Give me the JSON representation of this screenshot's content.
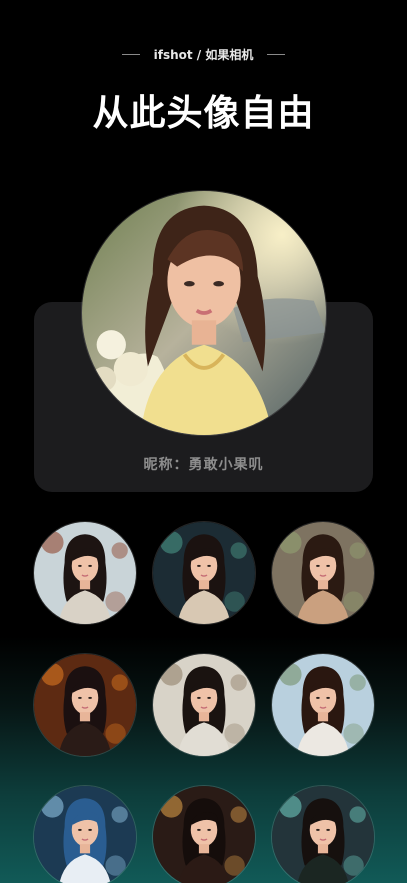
{
  "header": {
    "brand": "ifshot / 如果相机",
    "title": "从此头像自由"
  },
  "profile": {
    "nickname": "昵称：勇敢小果叽",
    "avatar_alt": "main-portrait"
  },
  "gallery": {
    "items": [
      {
        "name": "portrait-train-scarf",
        "bg": "#c9d4d8",
        "hair": "#1d1412",
        "shirt": "#d9d2c6",
        "accent": "#8a3b23"
      },
      {
        "name": "portrait-car-night",
        "bg": "#1c2c34",
        "hair": "#1b1210",
        "shirt": "#d8c8b3",
        "accent": "#4fa08e"
      },
      {
        "name": "portrait-nature-warm",
        "bg": "#7e7361",
        "hair": "#2b1a12",
        "shirt": "#caa07f",
        "accent": "#94a574"
      },
      {
        "name": "portrait-halloween",
        "bg": "#5d2a12",
        "hair": "#1b1010",
        "shirt": "#2a1b17",
        "accent": "#e57d22"
      },
      {
        "name": "portrait-vintage-car",
        "bg": "#d8d3c8",
        "hair": "#1a1310",
        "shirt": "#e1ddd4",
        "accent": "#8d7a63"
      },
      {
        "name": "portrait-lake-sky",
        "bg": "#b9d0de",
        "hair": "#2a1710",
        "shirt": "#ece8e2",
        "accent": "#6f8b60"
      },
      {
        "name": "portrait-bubbles-blue",
        "bg": "#1c3a53",
        "hair": "#2a5d91",
        "shirt": "#e8eef4",
        "accent": "#9bd0f0"
      },
      {
        "name": "portrait-fireworks",
        "bg": "#2a1b16",
        "hair": "#150d0b",
        "shirt": "#2b1a15",
        "accent": "#e5a54d"
      },
      {
        "name": "portrait-wizard-school",
        "bg": "#23343a",
        "hair": "#16100e",
        "shirt": "#1b2622",
        "accent": "#74d6c9"
      }
    ]
  }
}
